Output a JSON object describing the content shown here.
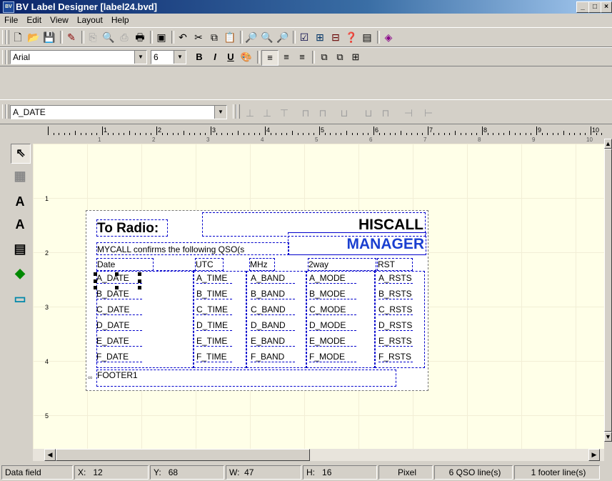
{
  "window": {
    "title": "BV Label Designer  [label24.bvd]",
    "icon": "app-icon",
    "min": "_",
    "max": "□",
    "close": "×"
  },
  "menu": [
    "File",
    "Edit",
    "View",
    "Layout",
    "Help"
  ],
  "toolbar1": {
    "icons": [
      "new-icon",
      "open-icon",
      "save-icon",
      "wizard-icon",
      "copy-page-icon",
      "print-preview-icon",
      "print-setup-icon",
      "print-icon",
      "window-icon",
      "undo-icon",
      "cut-icon",
      "copy-icon",
      "paste-icon",
      "zoom-out-icon",
      "zoom-in-icon",
      "zoom-fit-icon",
      "check-icon",
      "import-icon",
      "export-icon",
      "help-icon",
      "book-icon",
      "about-icon"
    ]
  },
  "toolbar2": {
    "font": "Arial",
    "size": "6",
    "bold": "B",
    "italic": "I",
    "underline": "U"
  },
  "toolbar3": {
    "field": "A_DATE"
  },
  "ruler": {
    "numbers": [
      "1",
      "2",
      "3",
      "4",
      "5",
      "6",
      "7",
      "8",
      "9",
      "10"
    ],
    "lower": [
      "1",
      "2",
      "3",
      "4",
      "5",
      "6",
      "7",
      "8",
      "9",
      "10"
    ]
  },
  "vruler": [
    "1",
    "2",
    "3",
    "4",
    "5"
  ],
  "label": {
    "to_radio": "To Radio:",
    "hiscall": "HISCALL",
    "manager": "MANAGER",
    "confirm": "MYCALL confirms the following QSO(s",
    "headers": [
      "Date",
      "UTC",
      "MHz",
      "2way",
      "RST"
    ],
    "rows": [
      [
        "A_DATE",
        "A_TIME",
        "A_BAND",
        "A_MODE",
        "A_RSTS"
      ],
      [
        "B_DATE",
        "B_TIME",
        "B_BAND",
        "B_MODE",
        "B_RSTS"
      ],
      [
        "C_DATE",
        "C_TIME",
        "C_BAND",
        "C_MODE",
        "C_RSTS"
      ],
      [
        "D_DATE",
        "D_TIME",
        "D_BAND",
        "D_MODE",
        "D_RSTS"
      ],
      [
        "E_DATE",
        "E_TIME",
        "E_BAND",
        "E_MODE",
        "E_RSTS"
      ],
      [
        "F_DATE",
        "F_TIME",
        "F_BAND",
        "F_MODE",
        "F_RSTS"
      ]
    ],
    "footer": "FOOTER1",
    "footer_marker": "∞"
  },
  "status": {
    "type": "Data field",
    "x_label": "X:",
    "x": "12",
    "y_label": "Y:",
    "y": "68",
    "w_label": "W:",
    "w": "47",
    "h_label": "H:",
    "h": "16",
    "unit": "Pixel",
    "qso": "6 QSO line(s)",
    "footer": "1 footer line(s)"
  }
}
